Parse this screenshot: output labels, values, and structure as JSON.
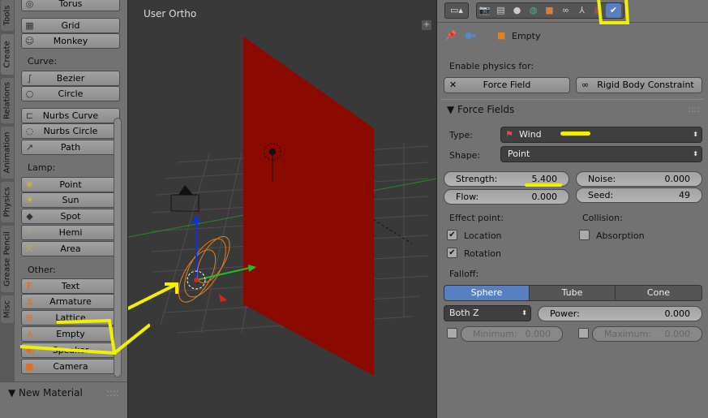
{
  "tool_tabs": [
    "Tools",
    "Create",
    "Relations",
    "Animation",
    "Physics",
    "Grease Pencil",
    "Misc"
  ],
  "active_tool_tab": "Create",
  "create_panel": {
    "items_top": [
      {
        "label": "Torus",
        "icon": "torus-icon"
      },
      {
        "label": "Grid",
        "icon": "grid-icon"
      },
      {
        "label": "Monkey",
        "icon": "monkey-icon"
      }
    ],
    "curve_label": "Curve:",
    "curve_items": [
      {
        "label": "Bezier",
        "icon": "bezier-icon"
      },
      {
        "label": "Circle",
        "icon": "circle-icon"
      }
    ],
    "nurbs_items": [
      {
        "label": "Nurbs Curve",
        "icon": "nurbs-curve-icon"
      },
      {
        "label": "Nurbs Circle",
        "icon": "nurbs-circle-icon"
      },
      {
        "label": "Path",
        "icon": "path-icon"
      }
    ],
    "lamp_label": "Lamp:",
    "lamp_items": [
      {
        "label": "Point",
        "icon": "point-lamp-icon"
      },
      {
        "label": "Sun",
        "icon": "sun-icon"
      },
      {
        "label": "Spot",
        "icon": "spot-icon"
      },
      {
        "label": "Hemi",
        "icon": "hemi-icon"
      },
      {
        "label": "Area",
        "icon": "area-icon"
      }
    ],
    "other_label": "Other:",
    "other_items": [
      {
        "label": "Text",
        "icon": "text-icon"
      },
      {
        "label": "Armature",
        "icon": "armature-icon"
      },
      {
        "label": "Lattice",
        "icon": "lattice-icon"
      },
      {
        "label": "Empty",
        "icon": "empty-icon"
      },
      {
        "label": "Speaker",
        "icon": "speaker-icon"
      },
      {
        "label": "Camera",
        "icon": "camera-icon"
      }
    ]
  },
  "material_panel": {
    "title": "New Material"
  },
  "viewport": {
    "title": "User Ortho"
  },
  "properties": {
    "breadcrumb_object": "Empty",
    "enable_physics_label": "Enable physics for:",
    "force_field_button": "Force Field",
    "rigid_body_button": "Rigid Body Constraint",
    "panel_title": "Force Fields",
    "type_label": "Type:",
    "type_value": "Wind",
    "shape_label": "Shape:",
    "shape_value": "Point",
    "strength_label": "Strength:",
    "strength_value": "5.400",
    "flow_label": "Flow:",
    "flow_value": "0.000",
    "noise_label": "Noise:",
    "noise_value": "0.000",
    "seed_label": "Seed:",
    "seed_value": "49",
    "effect_point_label": "Effect point:",
    "location_label": "Location",
    "location_checked": true,
    "rotation_label": "Rotation",
    "rotation_checked": true,
    "collision_label": "Collision:",
    "absorption_label": "Absorption",
    "absorption_checked": false,
    "falloff_label": "Falloff:",
    "falloff_options": [
      "Sphere",
      "Tube",
      "Cone"
    ],
    "falloff_selected": "Sphere",
    "z_direction_value": "Both Z",
    "power_label": "Power:",
    "power_value": "0.000",
    "minimum_label": "Minimum:",
    "minimum_value": "0.000",
    "maximum_label": "Maximum:",
    "maximum_value": "0.000"
  },
  "colors": {
    "accent": "#5680c2",
    "annotation": "#f0f000",
    "plane": "#8b0a00"
  }
}
